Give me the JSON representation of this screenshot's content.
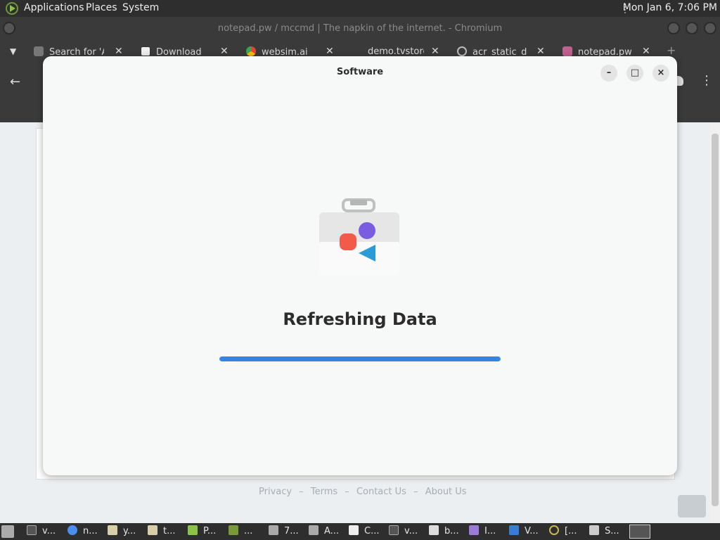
{
  "top_panel": {
    "menus": [
      "Applications",
      "Places",
      "System"
    ],
    "clock": "Mon Jan  6,  7:06 PM"
  },
  "browser": {
    "window_title": "notepad.pw / mccmd | The napkin of the internet. - Chromium",
    "tabs": [
      {
        "label": "Search for 'A",
        "icon": "search-icon"
      },
      {
        "label": "Download",
        "icon": "7zip-icon"
      },
      {
        "label": "websim.ai",
        "icon": "chrome-icon"
      },
      {
        "label": "demo.tvstore",
        "icon": ""
      },
      {
        "label": "acr_static_da",
        "icon": "globe-icon"
      },
      {
        "label": "notepad.pw /",
        "icon": "notepad-icon"
      }
    ],
    "new_tab": "+",
    "footer_links": [
      "Privacy",
      "–",
      "Terms",
      "–",
      "Contact Us",
      "–",
      "About Us"
    ]
  },
  "dialog": {
    "title": "Software",
    "heading": "Refreshing Data",
    "progress": 1.0,
    "controls": {
      "minimize": "–",
      "maximize": "□",
      "close": "×"
    }
  },
  "taskbar": {
    "items": [
      "v...",
      "n...",
      "y...",
      "t...",
      "P...",
      "...",
      "7...",
      "A...",
      "C...",
      "v...",
      "b...",
      "I...",
      "V...",
      "[...",
      "S..."
    ]
  },
  "colors": {
    "accent": "#3584e4",
    "panel": "#2e2e2e",
    "dialog_bg": "#f7f8f8"
  }
}
